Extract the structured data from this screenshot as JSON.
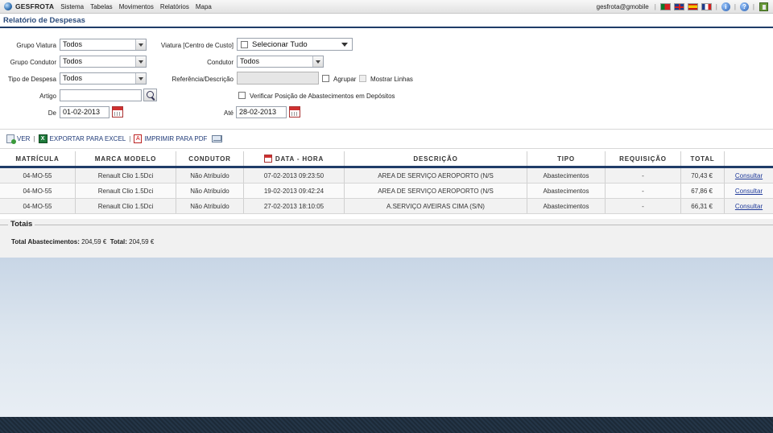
{
  "topbar": {
    "brand": "GESFROTA",
    "menu": [
      "Sistema",
      "Tabelas",
      "Movimentos",
      "Relatórios",
      "Mapa"
    ],
    "user": "gesfrota@gmobile",
    "info_icon": "i",
    "help_icon": "?"
  },
  "page": {
    "title": "Relatório de Despesas"
  },
  "form": {
    "grupo_viatura": {
      "label": "Grupo Viatura",
      "value": "Todos"
    },
    "grupo_condutor": {
      "label": "Grupo Condutor",
      "value": "Todos"
    },
    "tipo_despesa": {
      "label": "Tipo de Despesa",
      "value": "Todos"
    },
    "artigo": {
      "label": "Artigo",
      "value": ""
    },
    "de": {
      "label": "De",
      "value": "01-02-2013"
    },
    "viatura": {
      "label": "Viatura [Centro de Custo]",
      "value": "Selecionar Tudo"
    },
    "condutor": {
      "label": "Condutor",
      "value": "Todos"
    },
    "referencia": {
      "label": "Referência/Descrição",
      "value": ""
    },
    "agrupar": {
      "label": "Agrupar"
    },
    "mostrar_linhas": {
      "label": "Mostrar Linhas"
    },
    "verificar": {
      "label": "Verificar Posição de Abastecimentos em Depósitos"
    },
    "ate": {
      "label": "Até",
      "value": "28-02-2013"
    }
  },
  "toolbar": {
    "ver": "VER",
    "exportar": "EXPORTAR PARA EXCEL",
    "imprimir": "IMPRIMIR PARA PDF",
    "xls_glyph": "X",
    "pdf_glyph": "A"
  },
  "table": {
    "headers": {
      "matricula": "MATRÍCULA",
      "marca": "MARCA MODELO",
      "condutor": "CONDUTOR",
      "data": "DATA - HORA",
      "descricao": "DESCRIÇÃO",
      "tipo": "TIPO",
      "requisicao": "REQUISIÇÃO",
      "total": "TOTAL",
      "acao": ""
    },
    "rows": [
      {
        "matricula": "04-MO-55",
        "marca": "Renault Clio 1.5Dci",
        "condutor": "Não Atribuído",
        "data": "07-02-2013 09:23:50",
        "descricao": "AREA DE SERVIÇO AEROPORTO (N/S",
        "tipo": "Abastecimentos",
        "requisicao": "-",
        "total": "70,43 €",
        "acao": "Consultar"
      },
      {
        "matricula": "04-MO-55",
        "marca": "Renault Clio 1.5Dci",
        "condutor": "Não Atribuído",
        "data": "19-02-2013 09:42:24",
        "descricao": "AREA DE SERVIÇO AEROPORTO (N/S",
        "tipo": "Abastecimentos",
        "requisicao": "-",
        "total": "67,86 €",
        "acao": "Consultar"
      },
      {
        "matricula": "04-MO-55",
        "marca": "Renault Clio 1.5Dci",
        "condutor": "Não Atribuído",
        "data": "27-02-2013 18:10:05",
        "descricao": "A.SERVIÇO AVEIRAS CIMA (S/N)",
        "tipo": "Abastecimentos",
        "requisicao": "-",
        "total": "66,31 €",
        "acao": "Consultar"
      }
    ]
  },
  "totals": {
    "title": "Totais",
    "abastecimentos_label": "Total Abastecimentos:",
    "abastecimentos_value": "204,59 €",
    "total_label": "Total:",
    "total_value": "204,59 €"
  }
}
